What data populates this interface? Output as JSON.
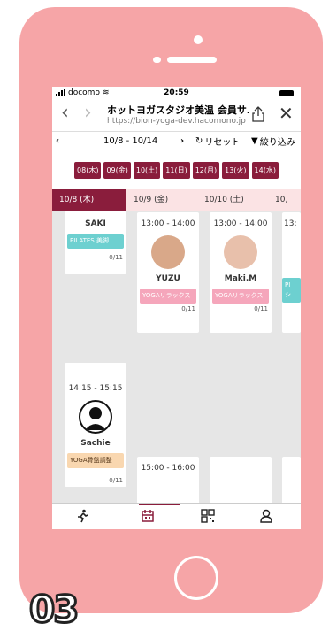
{
  "status": {
    "carrier": "docomo",
    "time": "20:59"
  },
  "browser": {
    "title": "ホットヨガスタジオ美温 会員サ…",
    "url": "https://bion-yoga-dev.hacomono.jp",
    "back_glyph": "‹",
    "forward_glyph": "›",
    "close_glyph": "✕"
  },
  "datebar": {
    "prev": "‹",
    "range": "10/8 - 10/14",
    "next": "›",
    "reset": "リセット",
    "filter": "絞り込み"
  },
  "day_chips": [
    "08(木)",
    "09(金)",
    "10(土)",
    "11(日)",
    "12(月)",
    "13(火)",
    "14(水)"
  ],
  "tabs": [
    {
      "label": "10/8 (木)"
    },
    {
      "label": "10/9 (金)"
    },
    {
      "label": "10/10 (土)"
    },
    {
      "label": "10,"
    }
  ],
  "cards": {
    "saki": {
      "name": "SAKI",
      "tag": "PILATES 美脚",
      "capacity": "0/11"
    },
    "yuzu": {
      "time": "13:00 - 14:00",
      "name": "YUZU",
      "tag": "YOGAリラックス",
      "capacity": "0/11"
    },
    "maki": {
      "time": "13:00 - 14:00",
      "name": "Maki.M",
      "tag": "YOGAリラックス",
      "capacity": "0/11"
    },
    "partial": {
      "time": "13:",
      "tag": "PI シ"
    },
    "sachie": {
      "time": "14:15 - 15:15",
      "name": "Sachie",
      "tag": "YOGA骨盤調整",
      "capacity": "0/11"
    },
    "fri2": {
      "time": "15:00 - 16:00"
    }
  },
  "corner_label": "03",
  "colors": {
    "phone": "#f6a5a7",
    "accent": "#8a1d3c",
    "tab_inactive": "#fbe3e4"
  }
}
